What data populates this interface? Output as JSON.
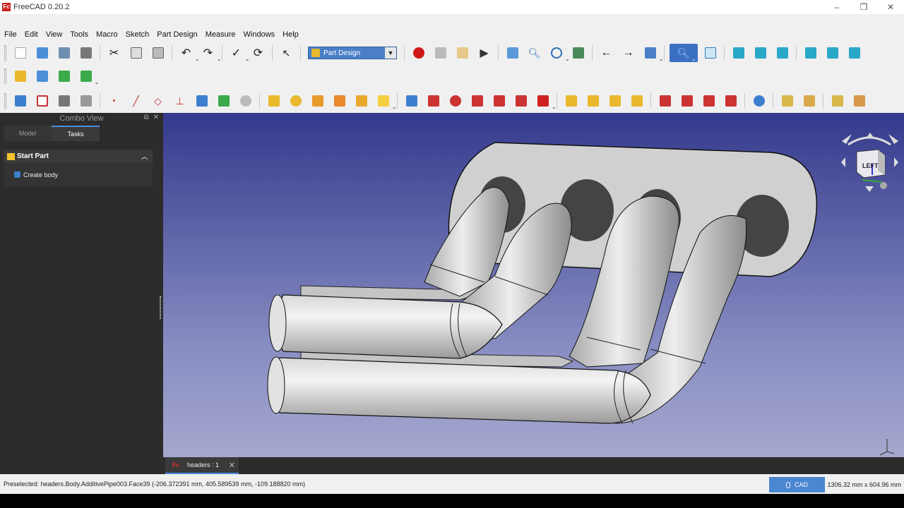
{
  "window": {
    "title": "FreeCAD 0.20.2",
    "app_icon": "Fc"
  },
  "menu": [
    "File",
    "Edit",
    "View",
    "Tools",
    "Macro",
    "Sketch",
    "Part Design",
    "Measure",
    "Windows",
    "Help"
  ],
  "workbench": {
    "selected": "Part Design"
  },
  "combo_view": {
    "title": "Combo View",
    "tabs": [
      "Model",
      "Tasks"
    ],
    "selected_tab": "Tasks",
    "panel_title": "Start Part",
    "action": "Create body"
  },
  "navcube": {
    "face_label": "LEFT"
  },
  "document_tab": {
    "label": "headers : 1"
  },
  "status": {
    "message": "Preselected: headers.Body.AdditivePipe003.Face39 (-206.372391 mm, 405.589539 mm, -109.188820 mm)",
    "nav_style": "CAD",
    "dimensions": "1306.32 mm x 604.96 mm"
  },
  "colors": {
    "accent": "#3b6fc2",
    "bg_top": "#343a8c",
    "bg_bottom": "#a5a7cc",
    "panel_dark": "#2c2c2c"
  }
}
